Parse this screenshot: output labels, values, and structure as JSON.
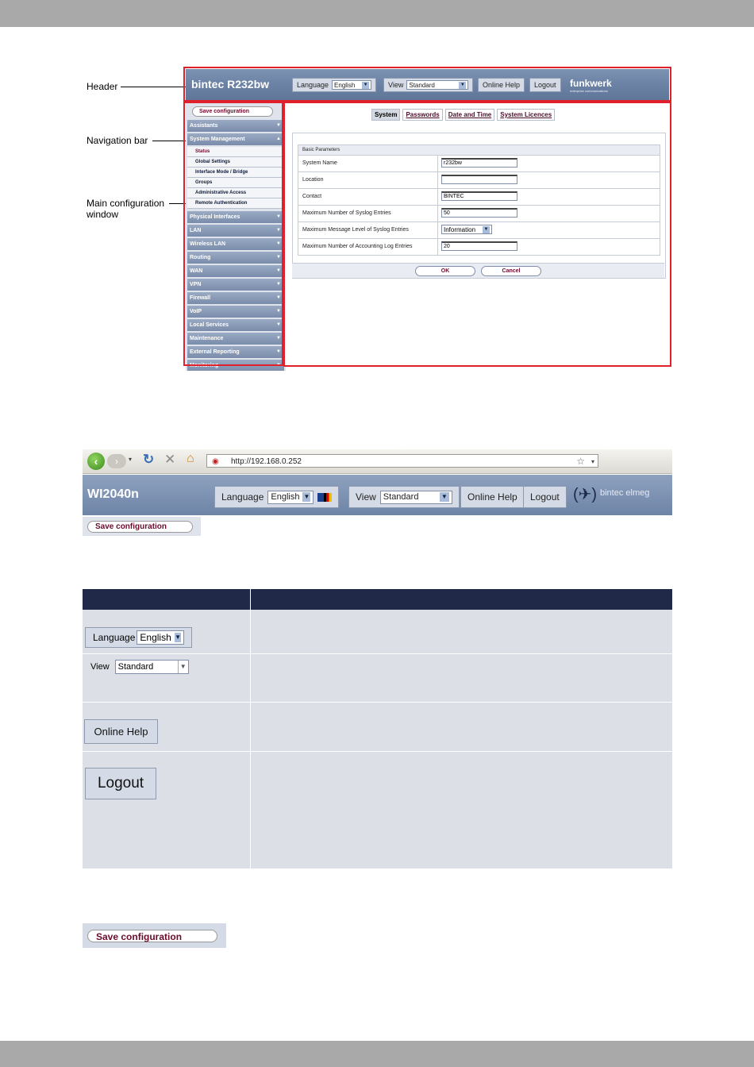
{
  "figure1": {
    "callouts": {
      "header": "Header",
      "navigation": "Navigation bar",
      "main_line1": "Main configuration",
      "main_line2": "window"
    },
    "header": {
      "device": "bintec R232bw",
      "language_label": "Language",
      "language_value": "English",
      "view_label": "View",
      "view_value": "Standard",
      "online_help": "Online Help",
      "logout": "Logout",
      "logo": "funkwerk",
      "logo_sub": "enterprise communications"
    },
    "nav": {
      "save": "Save configuration",
      "items": [
        "Assistants",
        "System Management"
      ],
      "subitems": [
        "Status",
        "Global Settings",
        "Interface Mode / Bridge",
        "Groups",
        "Administrative Access",
        "Remote Authentication"
      ],
      "items2": [
        "Physical Interfaces",
        "LAN",
        "Wireless LAN",
        "Routing",
        "WAN",
        "VPN",
        "Firewall",
        "VoIP",
        "Local Services",
        "Maintenance",
        "External Reporting",
        "Monitoring"
      ]
    },
    "main": {
      "tabs": [
        "System",
        "Passwords",
        "Date and Time",
        "System Licences"
      ],
      "section": "Basic Parameters",
      "rows": [
        {
          "label": "System Name",
          "value": "r232bw"
        },
        {
          "label": "Location",
          "value": ""
        },
        {
          "label": "Contact",
          "value": "BINTEC"
        },
        {
          "label": "Maximum Number of Syslog Entries",
          "value": "50"
        },
        {
          "label": "Maximum Message Level of Syslog Entries",
          "value": "Information"
        },
        {
          "label": "Maximum Number of Accounting Log Entries",
          "value": "20"
        }
      ],
      "ok": "OK",
      "cancel": "Cancel"
    }
  },
  "figure2": {
    "url": "http://192.168.0.252",
    "device": "WI2040n",
    "language_label": "Language",
    "language_value": "English",
    "view_label": "View",
    "view_value": "Standard",
    "online_help": "Online Help",
    "logout": "Logout",
    "logo": "bintec elmeg",
    "save": "Save configuration"
  },
  "table": {
    "language_label": "Language",
    "language_value": "English",
    "view_label": "View",
    "view_value": "Standard",
    "online_help": "Online Help",
    "logout": "Logout"
  },
  "save_button": "Save configuration"
}
